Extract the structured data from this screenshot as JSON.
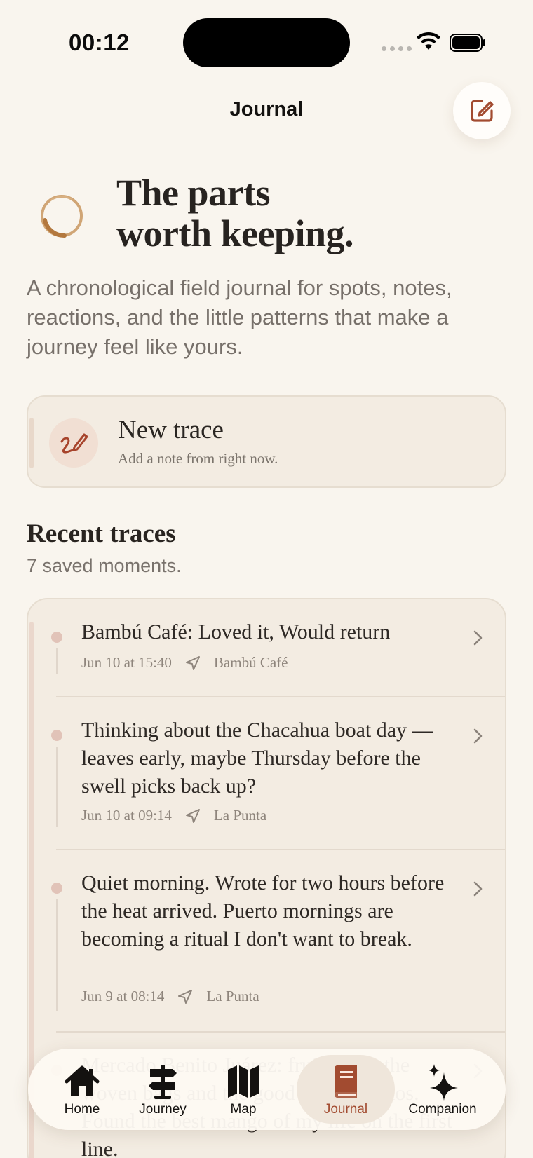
{
  "status_bar": {
    "time": "00:12"
  },
  "header": {
    "title": "Journal",
    "compose_icon": "compose-icon"
  },
  "hero": {
    "title_line1": "The parts",
    "title_line2": "worth keeping.",
    "subtitle": "A chronological field journal for spots, notes, reactions, and the little patterns that make a journey feel like yours."
  },
  "new_trace": {
    "title": "New trace",
    "subtitle": "Add a note from right now.",
    "icon": "scribble-pen-icon"
  },
  "recent": {
    "title": "Recent traces",
    "count_label": "7 saved moments.",
    "entries": [
      {
        "text": "Bambú Café: Loved it, Would return",
        "date": "Jun 10 at 15:40",
        "location": "Bambú Café"
      },
      {
        "text": "Thinking about the Chacahua boat day — leaves early, maybe Thursday before the swell picks back up?",
        "date": "Jun 10 at 09:14",
        "location": "La Punta"
      },
      {
        "text": "Quiet morning. Wrote for two hours before the heat arrived. Puerto mornings are becoming a ritual I don't want to break.",
        "date": "Jun 9 at 08:14",
        "location": "La Punta"
      },
      {
        "text": "Mercado Benito Juárez: fruit stand, the woven bags and the good kind of chaos. Found the best mango of my life on the first line.",
        "date": "",
        "location": ""
      }
    ]
  },
  "tab_bar": {
    "tabs": [
      {
        "label": "Home",
        "icon": "home-icon"
      },
      {
        "label": "Journey",
        "icon": "signpost-icon"
      },
      {
        "label": "Map",
        "icon": "map-icon"
      },
      {
        "label": "Journal",
        "icon": "book-icon",
        "active": true
      },
      {
        "label": "Companion",
        "icon": "sparkles-icon"
      }
    ]
  },
  "colors": {
    "accent": "#a24b30",
    "background": "#f9f5ee",
    "card": "#f3ece2"
  }
}
